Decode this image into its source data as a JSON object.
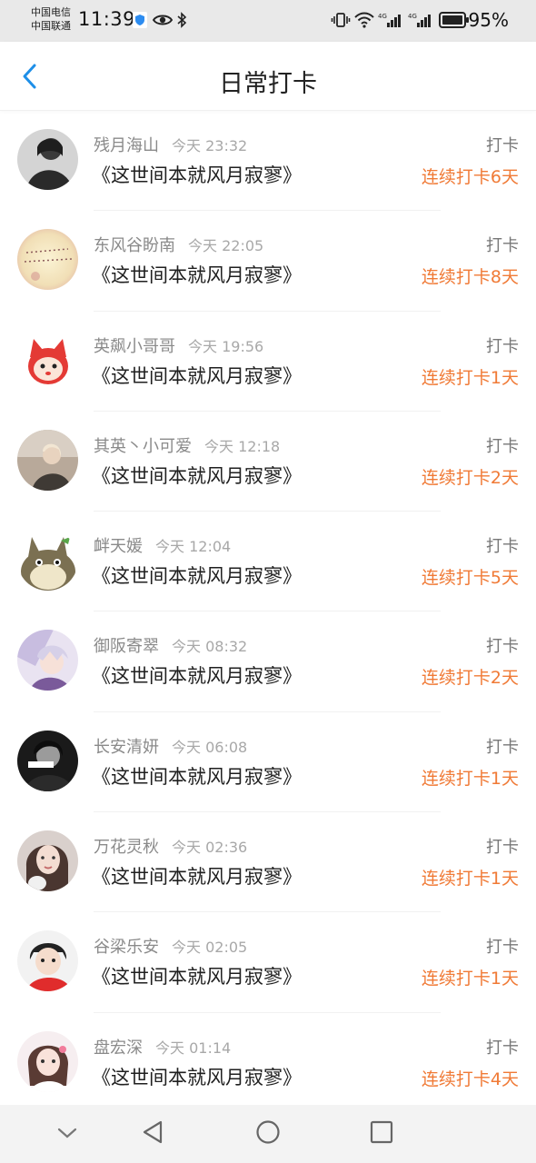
{
  "status_bar": {
    "carrier_1": "中国电信",
    "carrier_2": "中国联通",
    "time": "11:39",
    "battery": "95%"
  },
  "header": {
    "title": "日常打卡"
  },
  "checkin_label": "打卡",
  "entries": [
    {
      "name": "残月海山",
      "time": "今天 23:32",
      "content": "《这世间本就风月寂寥》",
      "streak": "连续打卡6天"
    },
    {
      "name": "东风谷盼南",
      "time": "今天 22:05",
      "content": "《这世间本就风月寂寥》",
      "streak": "连续打卡8天"
    },
    {
      "name": "英飙小哥哥",
      "time": "今天 19:56",
      "content": "《这世间本就风月寂寥》",
      "streak": "连续打卡1天"
    },
    {
      "name": "其英丶小可爱",
      "time": "今天 12:18",
      "content": "《这世间本就风月寂寥》",
      "streak": "连续打卡2天"
    },
    {
      "name": "衅天媛",
      "time": "今天 12:04",
      "content": "《这世间本就风月寂寥》",
      "streak": "连续打卡5天"
    },
    {
      "name": "御阪寄翠",
      "time": "今天 08:32",
      "content": "《这世间本就风月寂寥》",
      "streak": "连续打卡2天"
    },
    {
      "name": "长安清妍",
      "time": "今天 06:08",
      "content": "《这世间本就风月寂寥》",
      "streak": "连续打卡1天"
    },
    {
      "name": "万花灵秋",
      "time": "今天 02:36",
      "content": "《这世间本就风月寂寥》",
      "streak": "连续打卡1天"
    },
    {
      "name": "谷梁乐安",
      "time": "今天 02:05",
      "content": "《这世间本就风月寂寥》",
      "streak": "连续打卡1天"
    },
    {
      "name": "盘宏深",
      "time": "今天 01:14",
      "content": "《这世间本就风月寂寥》",
      "streak": "连续打卡4天"
    }
  ],
  "colors": {
    "accent_orange": "#f07a36",
    "back_arrow_blue": "#1e8fe8"
  }
}
